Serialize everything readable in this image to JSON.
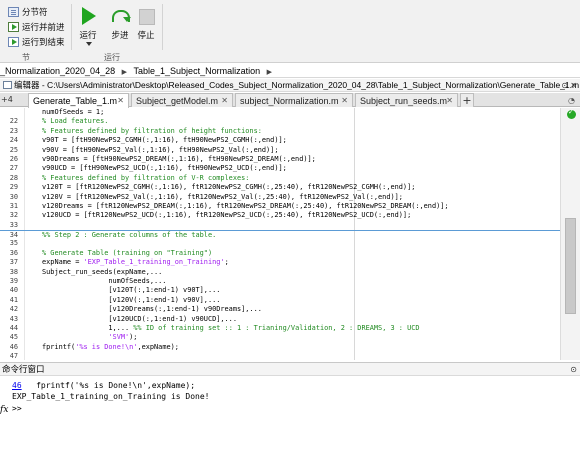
{
  "ribbon": {
    "left_items": [
      "分节符",
      "运行并前进",
      "运行到结束"
    ],
    "group_label_left": "节",
    "run_label": "运行",
    "step_label": "步进",
    "stop_label": "停止",
    "group_label_run": "运行"
  },
  "path": {
    "crumbs": [
      "_Normalization_2020_04_28",
      "Table_1_Subject_Normalization"
    ]
  },
  "editor": {
    "title": "编辑器 - C:\\Users\\Administrator\\Desktop\\Released_Codes_Subject_Normalization_2020_04_28\\Table_1_Subject_Normalization\\Generate_Table_1.m",
    "tab_scroll": "+4"
  },
  "tabs": [
    {
      "label": "Generate_Table_1.m"
    },
    {
      "label": "Subject_getModel.m"
    },
    {
      "label": "subject_Normalization.m"
    },
    {
      "label": "Subject_run_seeds.m"
    }
  ],
  "code_lines": [
    {
      "n": "",
      "t": "numOfSeeds = 1;"
    },
    {
      "n": "22",
      "t": "% Load features."
    },
    {
      "n": "23",
      "t": "% Features defined by filtration of height functions:"
    },
    {
      "n": "24",
      "t": "v90T = [ftH90NewPS2_CGMH(:,1:16), ftH90NewPS2_CGMH(:,end)];"
    },
    {
      "n": "25",
      "t": "v90V = [ftH90NewPS2_Val(:,1:16), ftH90NewPS2_Val(:,end)];"
    },
    {
      "n": "26",
      "t": "v90Dreams = [ftH90NewPS2_DREAM(:,1:16), ftH90NewPS2_DREAM(:,end)];"
    },
    {
      "n": "27",
      "t": "v90UCD = [ftH90NewPS2_UCD(:,1:16), ftH90NewPS2_UCD(:,end)];"
    },
    {
      "n": "28",
      "t": "% Features defined by filtration of V-R complexes:"
    },
    {
      "n": "29",
      "t": "v120T = [ftR120NewPS2_CGMH(:,1:16), ftR120NewPS2_CGMH(:,25:40), ftR120NewPS2_CGMH(:,end)];"
    },
    {
      "n": "30",
      "t": "v120V = [ftR120NewPS2_Val(:,1:16), ftR120NewPS2_Val(:,25:40), ftR120NewPS2_Val(:,end)];"
    },
    {
      "n": "31",
      "t": "v120Dreams = [ftR120NewPS2_DREAM(:,1:16), ftR120NewPS2_DREAM(:,25:40), ftR120NewPS2_DREAM(:,end)];"
    },
    {
      "n": "32",
      "t": "v120UCD = [ftR120NewPS2_UCD(:,1:16), ftR120NewPS2_UCD(:,25:40), ftR120NewPS2_UCD(:,end)];"
    },
    {
      "n": "33",
      "t": ""
    },
    {
      "n": "34",
      "t": "%% Step 2 : Generate columns of the table."
    },
    {
      "n": "35",
      "t": ""
    },
    {
      "n": "36",
      "t": "% Generate Table (training on \"Training\")"
    },
    {
      "n": "37",
      "t": "expName = 'EXP_Table_1_training_on_Training';"
    },
    {
      "n": "38",
      "t": "Subject_run_seeds(expName,..."
    },
    {
      "n": "39",
      "t": "                numOfSeeds,..."
    },
    {
      "n": "40",
      "t": "                [v120T(:,1:end-1) v90T],..."
    },
    {
      "n": "41",
      "t": "                [v120V(:,1:end-1) v90V],..."
    },
    {
      "n": "42",
      "t": "                [v120Dreams(:,1:end-1) v90Dreams],..."
    },
    {
      "n": "43",
      "t": "                [v120UCD(:,1:end-1) v90UCD],..."
    },
    {
      "n": "44",
      "t": "                1,... %% ID of training set :: 1 : Trianing/Validation, 2 : DREAMS, 3 : UCD"
    },
    {
      "n": "45",
      "t": "                'SVM');"
    },
    {
      "n": "46",
      "t": "fprintf('%s is Done!\\n',expName);"
    },
    {
      "n": "47",
      "t": ""
    }
  ],
  "command_window": {
    "title": "命令行窗口",
    "line_number": "46",
    "line_code": "fprintf('%s is Done!\\n',expName);",
    "output": "EXP_Table_1_training_on_Training is Done!",
    "fx_label": "fx",
    "prompt": ">>"
  },
  "colors": {
    "comment": "#228b22",
    "string": "#a020f0",
    "section": "#5b9bd5",
    "link": "#0000ee"
  }
}
